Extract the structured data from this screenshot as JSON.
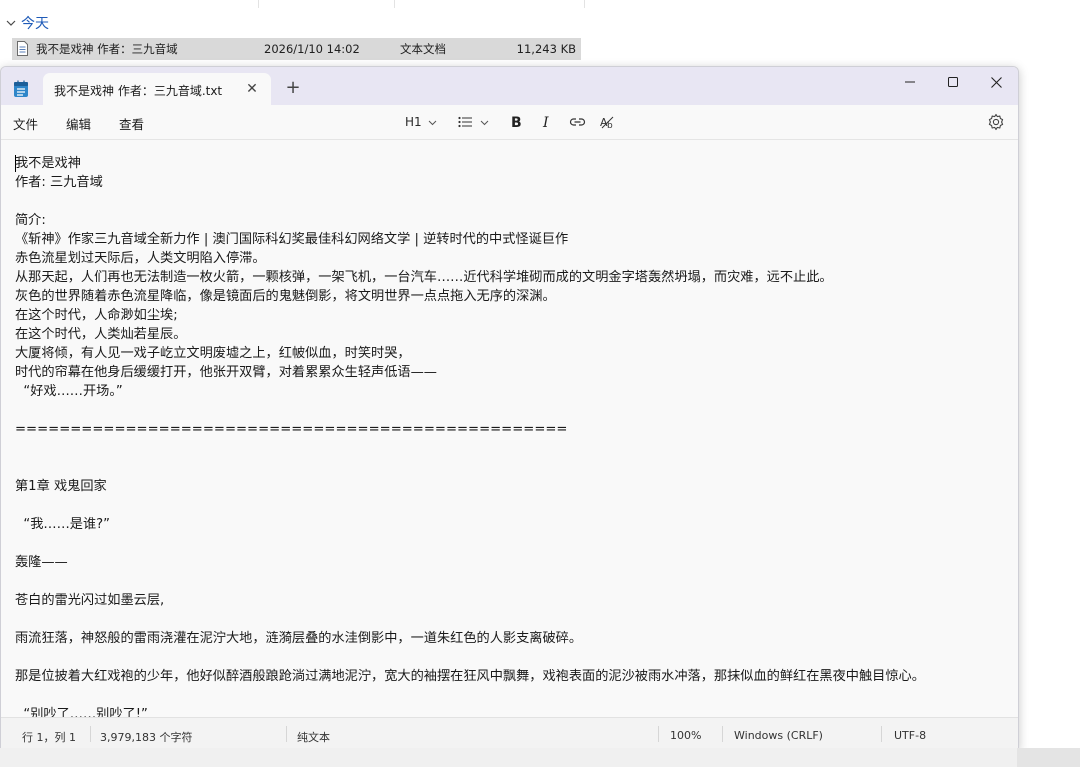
{
  "explorer": {
    "group_label": "今天",
    "file": {
      "name": "我不是戏神 作者：三九音域",
      "date": "2026/1/10 14:02",
      "type": "文本文档",
      "size": "11,243 KB"
    }
  },
  "window": {
    "tab_title": "我不是戏神 作者：三九音域.txt",
    "menu": {
      "file": "文件",
      "edit": "编辑",
      "view": "查看"
    },
    "toolbar": {
      "heading": "H1"
    }
  },
  "document": {
    "lines": [
      "我不是戏神",
      "作者: 三九音域",
      "",
      "简介:",
      "《斩神》作家三九音域全新力作 | 澳门国际科幻奖最佳科幻网络文学 | 逆转时代的中式怪诞巨作",
      "赤色流星划过天际后，人类文明陷入停滞。",
      "从那天起，人们再也无法制造一枚火箭，一颗核弹，一架飞机，一台汽车……近代科学堆砌而成的文明金字塔轰然坍塌，而灾难，远不止此。",
      "灰色的世界随着赤色流星降临，像是镜面后的鬼魅倒影，将文明世界一点点拖入无序的深渊。",
      "在这个时代，人命渺如尘埃;",
      "在这个时代，人类灿若星辰。",
      "大厦将倾，有人见一戏子屹立文明废墟之上，红帔似血，时笑时哭，",
      "时代的帘幕在他身后缓缓打开，他张开双臂，对着累累众生轻声低语——",
      "  “好戏……开场。”",
      "",
      "==================================================",
      "",
      "",
      "第1章 戏鬼回家",
      "",
      "  “我……是谁?”",
      "",
      "轰隆——",
      "",
      "苍白的雷光闪过如墨云层,",
      "",
      "雨流狂落，神怒般的雷雨浇灌在泥泞大地，涟漪层叠的水洼倒影中，一道朱红色的人影支离破碎。",
      "",
      "那是位披着大红戏袍的少年，他好似醉酒般踉跄淌过满地泥泞，宽大的袖摆在狂风中飘舞，戏袍表面的泥沙被雨水冲落，那抹似血的鲜红在黑夜中触目惊心。",
      "",
      "  “别吵了……别吵了!”"
    ]
  },
  "status": {
    "position": "行 1，列 1",
    "chars": "3,979,183 个字符",
    "format": "纯文本",
    "zoom": "100%",
    "line_ending": "Windows (CRLF)",
    "encoding": "UTF-8"
  },
  "colors": {
    "accent": "#1f5bb8",
    "titlebar": "#e8e6f3",
    "selected_row": "#d9d9d9"
  }
}
